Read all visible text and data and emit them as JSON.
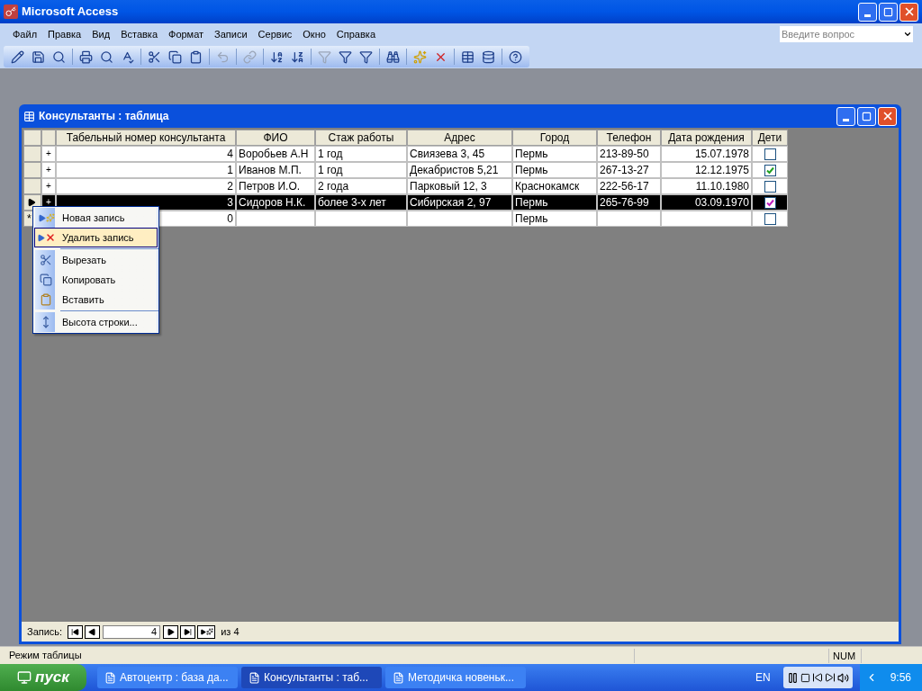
{
  "window": {
    "title": "Microsoft Access"
  },
  "menu": [
    "Файл",
    "Правка",
    "Вид",
    "Вставка",
    "Формат",
    "Записи",
    "Сервис",
    "Окно",
    "Справка"
  ],
  "help_box": {
    "placeholder": "Введите вопрос"
  },
  "table_window": {
    "title": "Консультанты : таблица"
  },
  "table": {
    "columns": [
      {
        "label": "Табельный номер консультанта",
        "kind": "number"
      },
      {
        "label": "ФИО",
        "kind": "text"
      },
      {
        "label": "Стаж работы",
        "kind": "text"
      },
      {
        "label": "Адрес",
        "kind": "text"
      },
      {
        "label": "Город",
        "kind": "text"
      },
      {
        "label": "Телефон",
        "kind": "text"
      },
      {
        "label": "Дата рождения",
        "kind": "date"
      },
      {
        "label": "Дети",
        "kind": "checkbox"
      }
    ],
    "rows": [
      {
        "kind": "record",
        "expander": "+",
        "selected": false,
        "cells": [
          "4",
          "Воробьев А.Н",
          "1 год",
          "Свиязева 3, 45",
          "Пермь",
          "213-89-50",
          "15.07.1978"
        ],
        "checked": false
      },
      {
        "kind": "record",
        "expander": "+",
        "selected": false,
        "cells": [
          "1",
          "Иванов М.П.",
          "1 год",
          "Декабристов 5,21",
          "Пермь",
          "267-13-27",
          "12.12.1975"
        ],
        "checked": true
      },
      {
        "kind": "record",
        "expander": "+",
        "selected": false,
        "cells": [
          "2",
          "Петров И.О.",
          "2 года",
          "Парковый 12, 3",
          "Краснокамск",
          "222-56-17",
          "11.10.1980"
        ],
        "checked": false
      },
      {
        "kind": "record",
        "expander": "+",
        "selected": true,
        "cells": [
          "3",
          "Сидоров Н.К.",
          "более 3-х лет",
          "Сибирская 2, 97",
          "Пермь",
          "265-76-99",
          "03.09.1970"
        ],
        "checked": true
      },
      {
        "kind": "new",
        "marker": "*",
        "selected": false,
        "cells": [
          "0",
          "",
          "",
          "",
          "Пермь",
          "",
          ""
        ],
        "checked": false
      }
    ]
  },
  "context_menu": [
    {
      "label": "Новая запись",
      "kind": "new",
      "selected": false,
      "group_start": false
    },
    {
      "label": "Удалить запись",
      "kind": "delete",
      "selected": true,
      "group_start": false
    },
    {
      "label": "Вырезать",
      "kind": "cut",
      "selected": false,
      "group_start": true
    },
    {
      "label": "Копировать",
      "kind": "copy",
      "selected": false,
      "group_start": false
    },
    {
      "label": "Вставить",
      "kind": "paste",
      "selected": false,
      "group_start": false
    },
    {
      "label": "Высота строки...",
      "kind": "height",
      "selected": false,
      "group_start": true
    }
  ],
  "navigator": {
    "label": "Запись:",
    "value": "4",
    "total": "из 4"
  },
  "status_bar": {
    "mode": "Режим таблицы",
    "num": "NUM"
  },
  "taskbar": {
    "start": "пуск",
    "tasks": [
      {
        "label": "Автоцентр : база да...",
        "selected": false
      },
      {
        "label": "Консультанты : таб...",
        "selected": true
      },
      {
        "label": "Методичка новеньк...",
        "selected": false
      }
    ],
    "language": "EN",
    "time": "9:56"
  }
}
